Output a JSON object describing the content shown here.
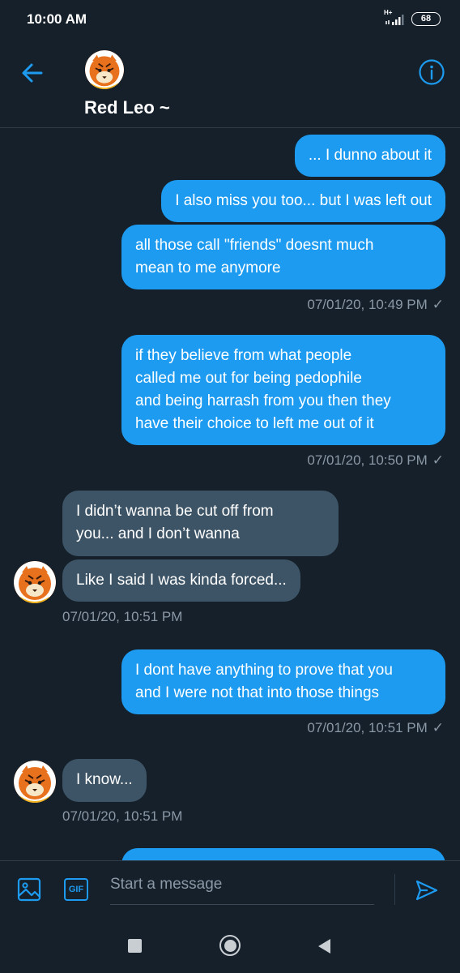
{
  "status_bar": {
    "time": "10:00 AM",
    "network": "H+",
    "battery": "68"
  },
  "header": {
    "contact_name": "Red Leo ~",
    "back_icon": "arrow-left-icon",
    "info_icon": "info-icon"
  },
  "messages": [
    {
      "direction": "out",
      "text": "... I dunno about it"
    },
    {
      "direction": "out",
      "text": "I also miss you too... but I was left out"
    },
    {
      "direction": "out",
      "text_line1": "all those call \"friends\" doesnt much",
      "text_line2": "mean to me anymore"
    },
    {
      "direction": "out",
      "timestamp": "07/01/20, 10:49 PM"
    },
    {
      "direction": "out",
      "lines": [
        "if they believe from what people",
        "called me out for being pedophile",
        "and being harrash from you then they",
        "have their choice to left me out of it"
      ],
      "timestamp": "07/01/20, 10:50 PM"
    },
    {
      "direction": "in",
      "lines": [
        "I didn’t wanna be cut off from",
        "you... and I don’t wanna"
      ]
    },
    {
      "direction": "in",
      "text": "Like I said I was kinda forced...",
      "timestamp": "07/01/20, 10:51 PM"
    },
    {
      "direction": "out",
      "lines": [
        "I dont have anything to prove that you",
        "and I were not that into those things"
      ],
      "timestamp": "07/01/20, 10:51 PM"
    },
    {
      "direction": "in",
      "text": "I know...",
      "timestamp": "07/01/20, 10:51 PM"
    }
  ],
  "composer": {
    "placeholder": "Start a message",
    "gif_label": "GIF",
    "image_icon": "image-icon",
    "send_icon": "send-icon"
  },
  "colors": {
    "background": "#15202b",
    "outgoing_bubble": "#1d9bf0",
    "incoming_bubble": "#3d5466",
    "accent": "#1d9bf0",
    "timestamp": "#8b98a5"
  }
}
